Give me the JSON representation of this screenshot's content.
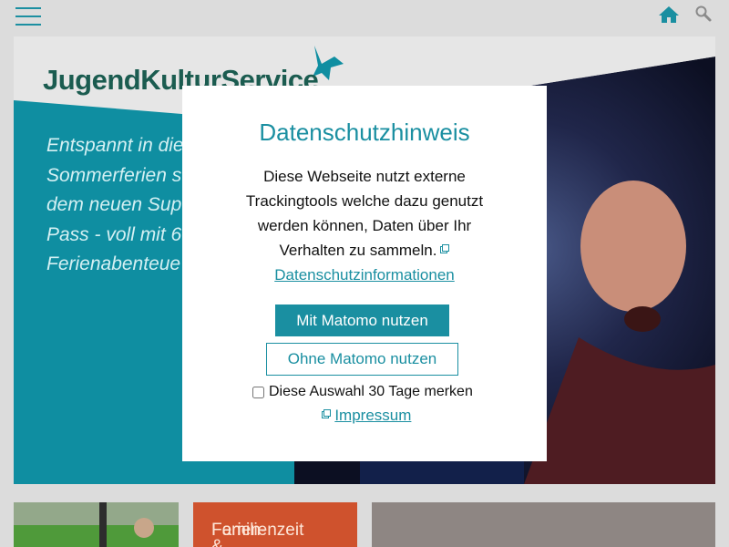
{
  "header": {
    "menu_icon": "hamburger-menu-icon",
    "home_icon": "home-icon",
    "search_icon": "search-icon"
  },
  "hero": {
    "logo_text": "JugendKulturService",
    "text_lines": [
      "Entspannt in die",
      "Sommerferien s",
      "dem neuen Sup",
      "Pass - voll mit 6",
      "Ferienabenteue"
    ]
  },
  "tiles": {
    "orange_label_line1": "Ferien- &",
    "orange_label_line2": "Familienzeit"
  },
  "modal": {
    "title": "Datenschutzhinweis",
    "body_line1": "Diese Webseite nutzt externe",
    "body_line2": "Trackingtools welche dazu genutzt",
    "body_line3": "werden können, Daten über Ihr",
    "body_line4": "Verhalten zu sammeln.",
    "privacy_link": "Datenschutzinformationen",
    "primary_button": "Mit Matomo nutzen",
    "secondary_button": "Ohne Matomo nutzen",
    "remember_label": "Diese Auswahl 30 Tage merken",
    "impressum_link": "Impressum"
  },
  "colors": {
    "accent": "#1a8fa1",
    "orange": "#cf522d",
    "background": "#dcdcdc"
  }
}
